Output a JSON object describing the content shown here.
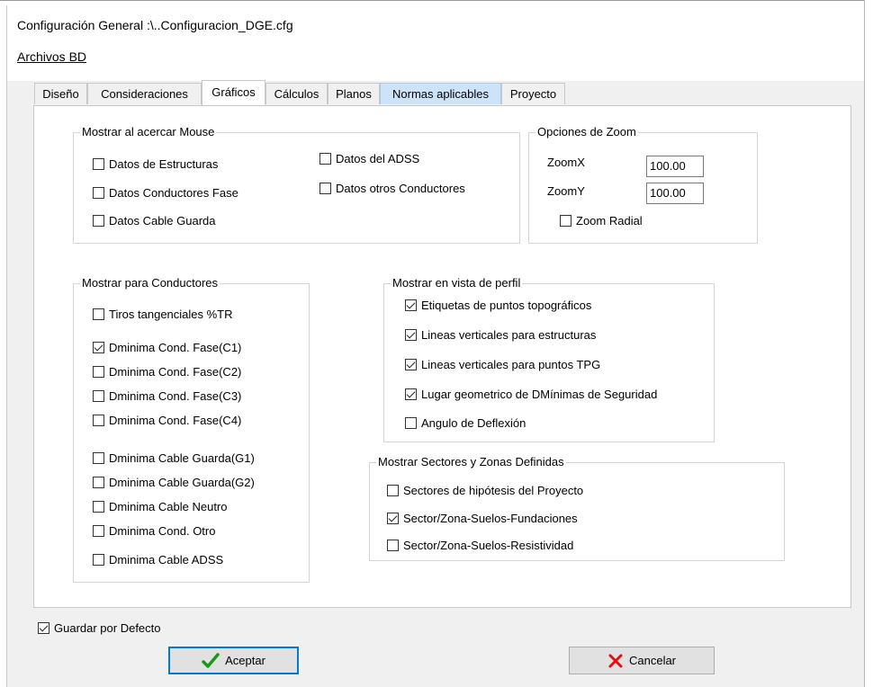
{
  "window": {
    "title": "Configuración General :\\..Configuracion_DGE.cfg"
  },
  "menu": {
    "archivos_bd": "Archivos BD"
  },
  "tabs": [
    {
      "label": "Diseño"
    },
    {
      "label": "Consideraciones"
    },
    {
      "label": "Gráficos",
      "active": true
    },
    {
      "label": "Cálculos"
    },
    {
      "label": "Planos"
    },
    {
      "label": "Normas aplicables",
      "highlight": true
    },
    {
      "label": "Proyecto"
    }
  ],
  "mouse_group": {
    "legend": "Mostrar al acercar Mouse",
    "items": [
      {
        "label": "Datos de Estructuras",
        "checked": false
      },
      {
        "label": "Datos Conductores Fase",
        "checked": false
      },
      {
        "label": "Datos Cable Guarda",
        "checked": false
      },
      {
        "label": "Datos del ADSS",
        "checked": false
      },
      {
        "label": "Datos otros Conductores",
        "checked": false
      }
    ]
  },
  "zoom_group": {
    "legend": "Opciones de Zoom",
    "zoomx_label": "ZoomX",
    "zoomx_value": "100.00",
    "zoomy_label": "ZoomY",
    "zoomy_value": "100.00",
    "radial_label": "Zoom Radial",
    "radial_checked": false
  },
  "conductores_group": {
    "legend": "Mostrar para Conductores",
    "items": [
      {
        "label": "Tiros tangenciales %TR",
        "checked": false
      },
      {
        "label": "Dminima Cond. Fase(C1)",
        "checked": true
      },
      {
        "label": "Dminima Cond. Fase(C2)",
        "checked": false
      },
      {
        "label": "Dminima Cond. Fase(C3)",
        "checked": false
      },
      {
        "label": "Dminima Cond. Fase(C4)",
        "checked": false
      },
      {
        "label": "Dminima Cable Guarda(G1)",
        "checked": false
      },
      {
        "label": "Dminima Cable Guarda(G2)",
        "checked": false
      },
      {
        "label": "Dminima Cable Neutro",
        "checked": false
      },
      {
        "label": "Dminima Cond. Otro",
        "checked": false
      },
      {
        "label": "Dminima Cable ADSS",
        "checked": false
      }
    ]
  },
  "perfil_group": {
    "legend": "Mostrar en vista de perfil",
    "items": [
      {
        "label": "Etiquetas de puntos topográficos",
        "checked": true
      },
      {
        "label": "Lineas verticales para estructuras",
        "checked": true
      },
      {
        "label": "Lineas verticales para puntos TPG",
        "checked": true
      },
      {
        "label": "Lugar geometrico de DMínimas de Seguridad",
        "checked": true
      },
      {
        "label": "Angulo de Deflexión",
        "checked": false
      }
    ]
  },
  "sectores_group": {
    "legend": "Mostrar Sectores y Zonas Definidas",
    "items": [
      {
        "label": "Sectores de hipótesis del Proyecto",
        "checked": false
      },
      {
        "label": "Sector/Zona-Suelos-Fundaciones",
        "checked": true
      },
      {
        "label": "Sector/Zona-Suelos-Resistividad",
        "checked": false
      }
    ]
  },
  "footer": {
    "default_label": "Guardar por Defecto",
    "default_checked": true,
    "accept_label": "Aceptar",
    "cancel_label": "Cancelar",
    "accept_icon": "checkmark-icon",
    "cancel_icon": "x-icon",
    "accept_icon_color": "#1a9a1a",
    "cancel_icon_color": "#e01010"
  }
}
